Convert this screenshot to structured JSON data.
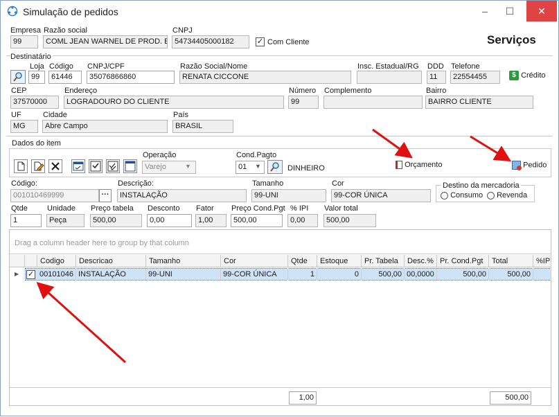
{
  "window": {
    "title": "Simulação de pedidos",
    "minimize": "–",
    "maximize": "☐",
    "close": "✕"
  },
  "header": {
    "empresa_label": "Empresa",
    "empresa": "99",
    "razao_label": "Razão social",
    "razao": "COML JEAN WARNEL DE PROD. ESP.",
    "cnpj_label": "CNPJ",
    "cnpj": "54734405000182",
    "com_cliente_label": "Com Cliente",
    "com_cliente_checked": true,
    "servicos": "Serviços"
  },
  "destinatario": {
    "section": "Destinatário",
    "loja_label": "Loja",
    "loja": "99",
    "codigo_label": "Código",
    "codigo": "61446",
    "cnpjcpf_label": "CNPJ/CPF",
    "cnpjcpf": "35076866860",
    "razao_label": "Razão Social/Nome",
    "razao": "RENATA CICCONE",
    "insc_label": "Insc. Estadual/RG",
    "insc": "",
    "ddd_label": "DDD",
    "ddd": "11",
    "telefone_label": "Telefone",
    "telefone": "22554455",
    "credito": "Crédito",
    "cep_label": "CEP",
    "cep": "37570000",
    "endereco_label": "Endereço",
    "endereco": "LOGRADOURO DO CLIENTE",
    "numero_label": "Número",
    "numero": "99",
    "complemento_label": "Complemento",
    "complemento": "",
    "bairro_label": "Bairro",
    "bairro": "BAIRRO CLIENTE",
    "uf_label": "UF",
    "uf": "MG",
    "cidade_label": "Cidade",
    "cidade": "Abre Campo",
    "pais_label": "País",
    "pais": "BRASIL"
  },
  "item": {
    "section": "Dados do item",
    "operacao_label": "Operação",
    "operacao": "Varejo",
    "cond_label": "Cond.Pagto",
    "cond": "01",
    "cond_desc": "DINHEIRO",
    "orcamento": "Orçamento",
    "pedido": "Pedido",
    "codigo_label": "Código:",
    "codigo": "001010469999",
    "descricao_label": "Descrição:",
    "descricao": "INSTALAÇÃO",
    "tamanho_label": "Tamanho",
    "tamanho": "99-UNI",
    "cor_label": "Cor",
    "cor": "99-COR ÚNICA",
    "destino_label": "Destino da mercadoria",
    "consumo": "Consumo",
    "revenda": "Revenda",
    "qtde_label": "Qtde",
    "qtde": "1",
    "unidade_label": "Unidade",
    "unidade": "Peça",
    "preco_tabela_label": "Preço tabela",
    "preco_tabela": "500,00",
    "desconto_label": "Desconto",
    "desconto": "0,00",
    "fator_label": "Fator",
    "fator": "1,00",
    "preco_cond_label": "Preço Cond.Pgt",
    "preco_cond": "500,00",
    "ipi_label": "% IPI",
    "ipi": "0,00",
    "valor_total_label": "Valor total",
    "valor_total": "500,00"
  },
  "grid": {
    "group_hint": "Drag a column header here to group by that column",
    "columns": [
      "Codigo",
      "Descricao",
      "Tamanho",
      "Cor",
      "Qtde",
      "Estoque",
      "Pr. Tabela",
      "Desc.%",
      "Pr. Cond.Pgt",
      "Total",
      "%IPI"
    ],
    "row": {
      "checked": true,
      "codigo": "00101046",
      "descricao": "INSTALAÇÃO",
      "tamanho": "99-UNI",
      "cor": "99-COR ÚNICA",
      "qtde": "1",
      "estoque": "0",
      "pr_tabela": "500,00",
      "desc": "00,0000",
      "pr_cond": "500,00",
      "total": "500,00",
      "ipi": ""
    },
    "footer_qtde": "1,00",
    "footer_total": "500,00"
  }
}
